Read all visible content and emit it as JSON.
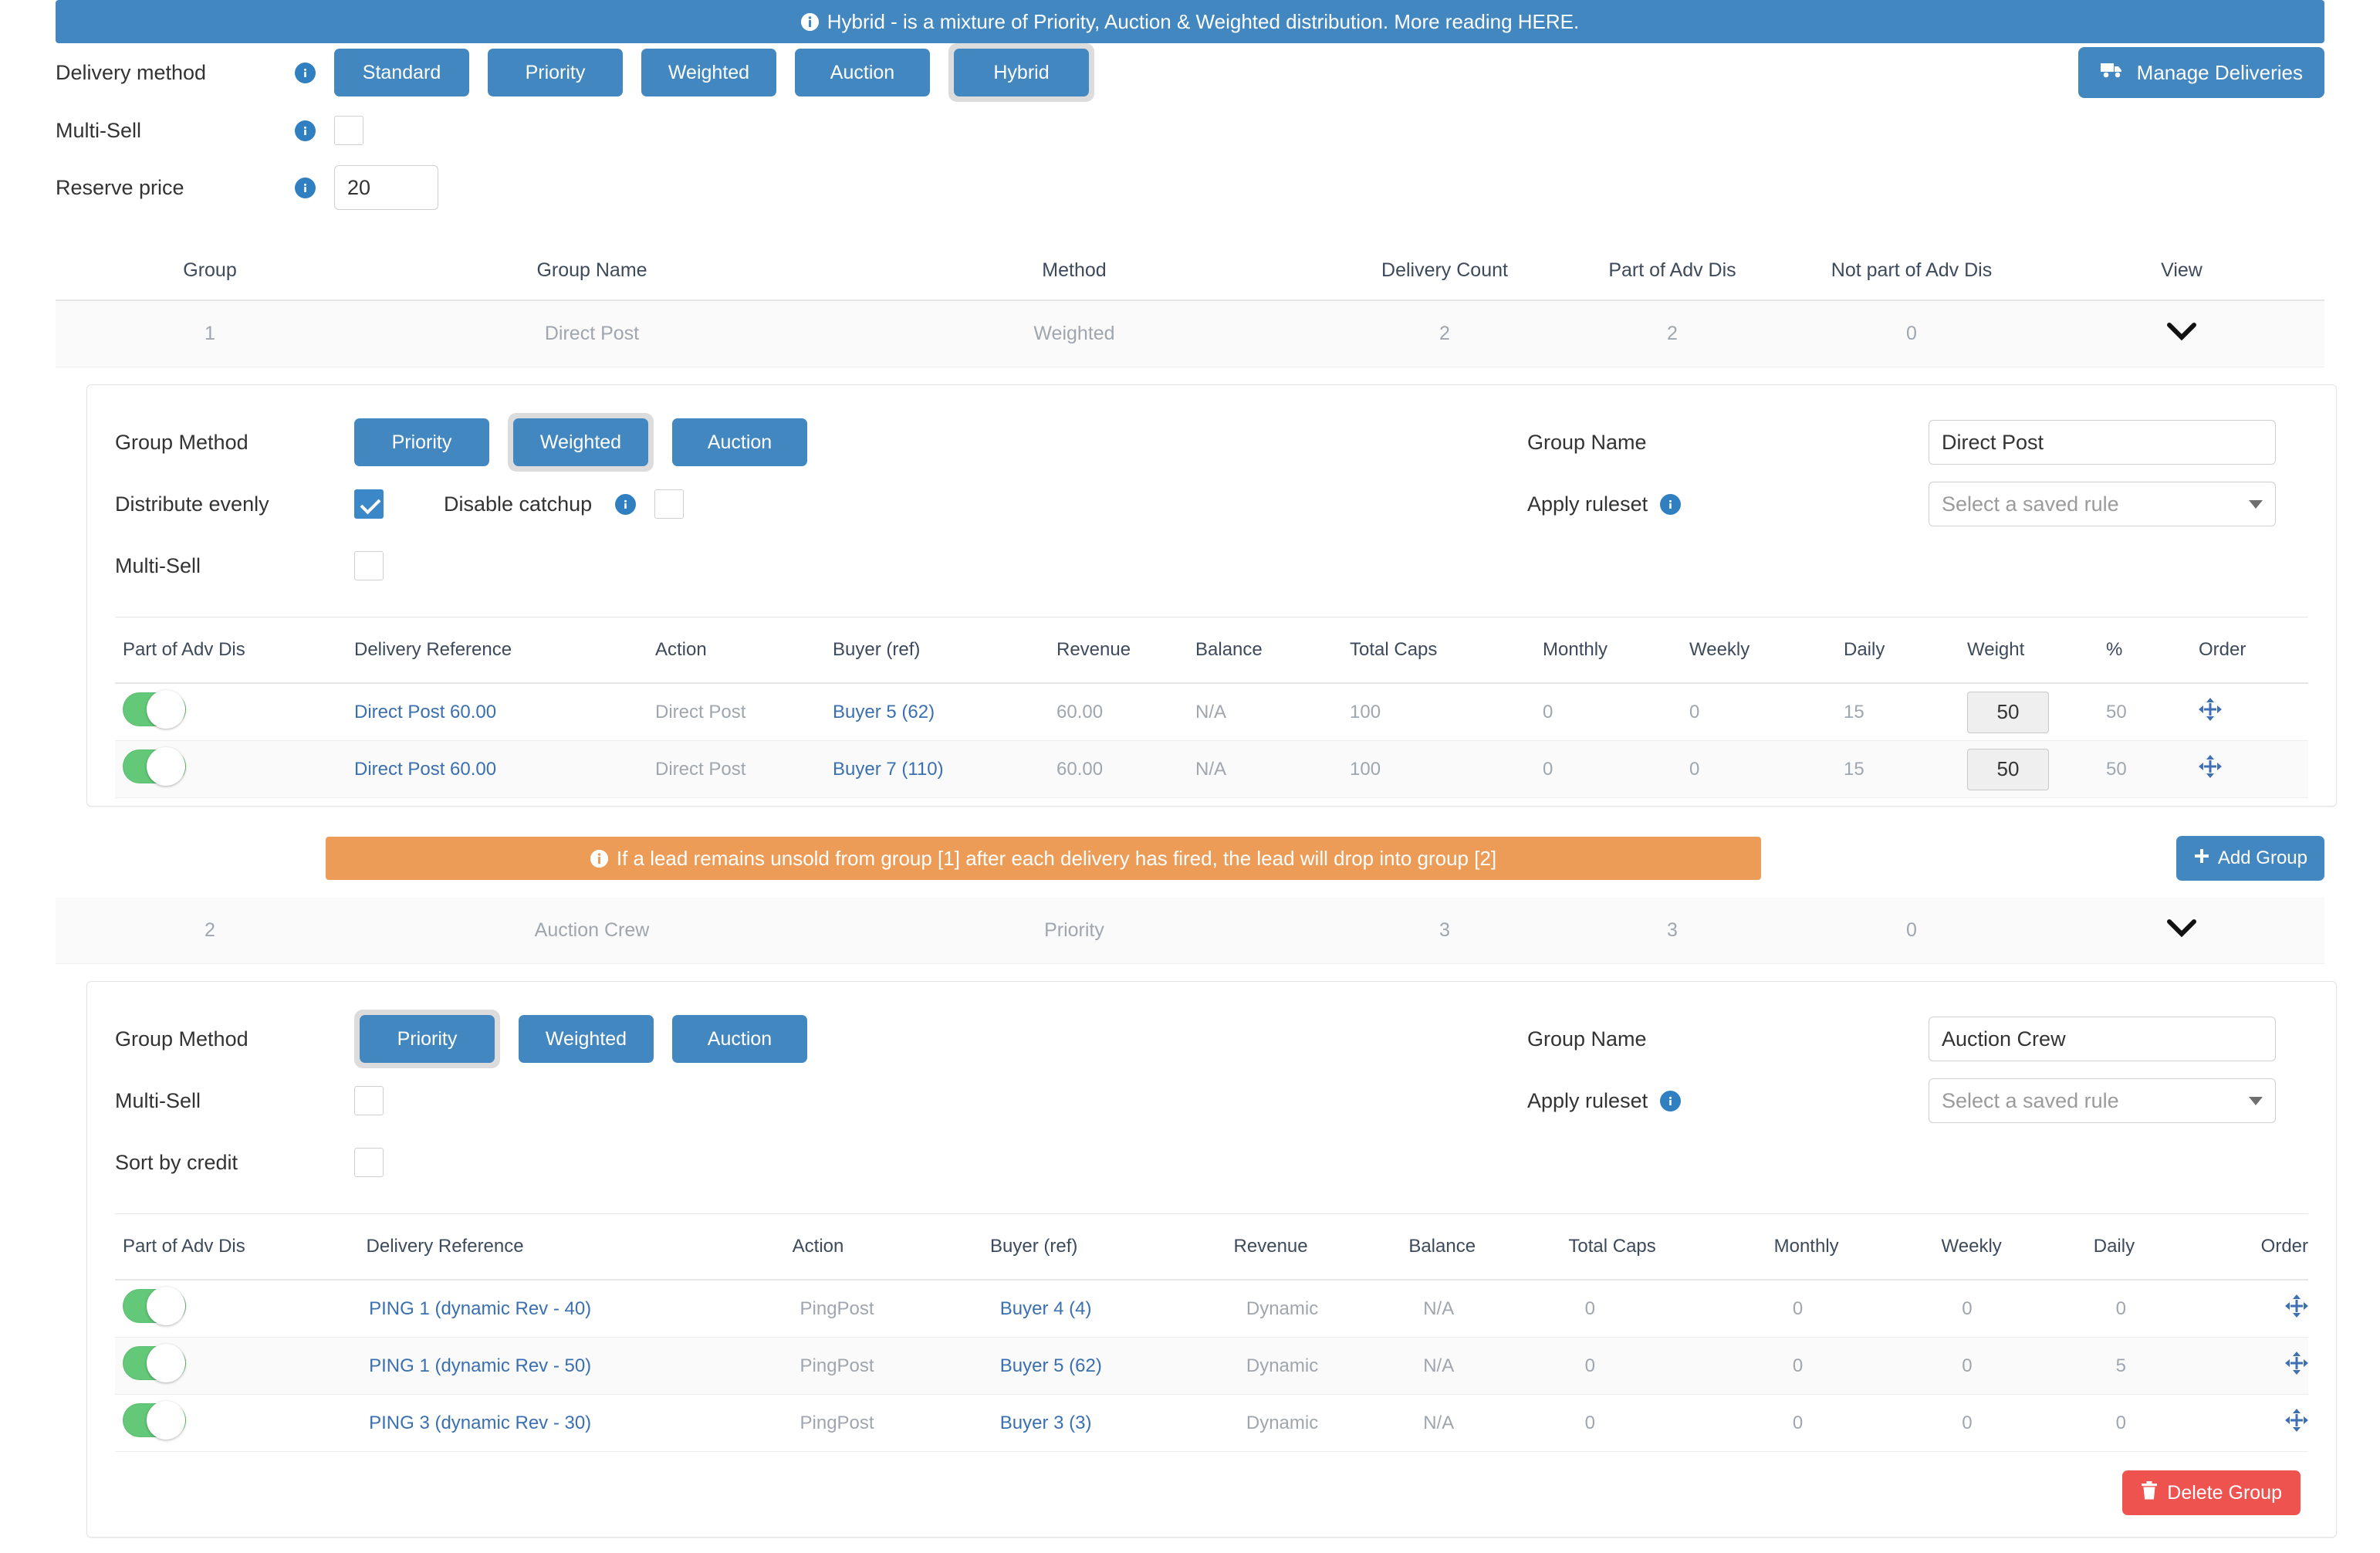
{
  "top_banner": {
    "icon": "info-icon",
    "text": "Hybrid - is a mixture of Priority, Auction & Weighted distribution. More reading HERE."
  },
  "delivery_method": {
    "label": "Delivery method",
    "info_icon": "info-icon",
    "options": [
      "Standard",
      "Priority",
      "Weighted",
      "Auction",
      "Hybrid"
    ],
    "selected": "Hybrid"
  },
  "manage_deliveries": {
    "label": "Manage Deliveries",
    "icon": "truck-icon"
  },
  "multi_sell": {
    "label": "Multi-Sell",
    "info_icon": "info-icon",
    "checked": false
  },
  "reserve_price": {
    "label": "Reserve price",
    "info_icon": "info-icon",
    "value": "20"
  },
  "group_table": {
    "headers": [
      "Group",
      "Group Name",
      "Method",
      "Delivery Count",
      "Part of Adv Dis",
      "Not part of Adv Dis",
      "View"
    ],
    "rows": [
      {
        "group": "1",
        "name": "Direct Post",
        "method": "Weighted",
        "delivery_count": "2",
        "part_adv": "2",
        "not_part_adv": "0",
        "view_icon": "chevron-down-icon"
      },
      {
        "group": "2",
        "name": "Auction Crew",
        "method": "Priority",
        "delivery_count": "3",
        "part_adv": "3",
        "not_part_adv": "0",
        "view_icon": "chevron-down-icon"
      }
    ]
  },
  "middle_banner": {
    "icon": "info-icon",
    "text": "If a lead remains unsold from group [1] after each delivery has fired, the lead will drop into group [2]"
  },
  "add_group": {
    "label": "Add Group",
    "icon": "plus-icon"
  },
  "delete_group": {
    "label": "Delete Group",
    "icon": "trash-icon"
  },
  "group1": {
    "group_method": {
      "label": "Group Method",
      "options": [
        "Priority",
        "Weighted",
        "Auction"
      ],
      "selected": "Weighted"
    },
    "distribute_evenly": {
      "label": "Distribute evenly",
      "checked": true
    },
    "disable_catchup": {
      "label": "Disable catchup",
      "info_icon": "info-icon",
      "checked": false
    },
    "multi_sell": {
      "label": "Multi-Sell",
      "checked": false
    },
    "group_name": {
      "label": "Group Name",
      "value": "Direct Post"
    },
    "apply_ruleset": {
      "label": "Apply ruleset",
      "info_icon": "info-icon",
      "placeholder": "Select a saved rule"
    },
    "delivery_headers": [
      "Part of Adv Dis",
      "Delivery Reference",
      "Action",
      "Buyer (ref)",
      "Revenue",
      "Balance",
      "Total Caps",
      "Monthly",
      "Weekly",
      "Daily",
      "Weight",
      "%",
      "Order"
    ],
    "deliveries": [
      {
        "part_of_adv_dis": true,
        "reference": "Direct Post 60.00",
        "action": "Direct Post",
        "buyer": "Buyer 5 (62)",
        "revenue": "60.00",
        "balance": "N/A",
        "total_caps": "100",
        "monthly": "0",
        "weekly": "0",
        "daily": "15",
        "weight": "50",
        "percent": "50",
        "order_icon": "move-icon"
      },
      {
        "part_of_adv_dis": true,
        "reference": "Direct Post 60.00",
        "action": "Direct Post",
        "buyer": "Buyer 7 (110)",
        "revenue": "60.00",
        "balance": "N/A",
        "total_caps": "100",
        "monthly": "0",
        "weekly": "0",
        "daily": "15",
        "weight": "50",
        "percent": "50",
        "order_icon": "move-icon"
      }
    ]
  },
  "group2": {
    "group_method": {
      "label": "Group Method",
      "options": [
        "Priority",
        "Weighted",
        "Auction"
      ],
      "selected": "Priority"
    },
    "multi_sell": {
      "label": "Multi-Sell",
      "checked": false
    },
    "sort_by_credit": {
      "label": "Sort by credit",
      "checked": false
    },
    "group_name": {
      "label": "Group Name",
      "value": "Auction Crew"
    },
    "apply_ruleset": {
      "label": "Apply ruleset",
      "info_icon": "info-icon",
      "placeholder": "Select a saved rule"
    },
    "delivery_headers": [
      "Part of Adv Dis",
      "Delivery Reference",
      "Action",
      "Buyer (ref)",
      "Revenue",
      "Balance",
      "Total Caps",
      "Monthly",
      "Weekly",
      "Daily",
      "Order"
    ],
    "deliveries": [
      {
        "part_of_adv_dis": true,
        "reference": "PING 1 (dynamic Rev - 40)",
        "action": "PingPost",
        "buyer": "Buyer 4 (4)",
        "revenue": "Dynamic",
        "balance": "N/A",
        "total_caps": "0",
        "monthly": "0",
        "weekly": "0",
        "daily": "0",
        "order_icon": "move-icon"
      },
      {
        "part_of_adv_dis": true,
        "reference": "PING 1 (dynamic Rev - 50)",
        "action": "PingPost",
        "buyer": "Buyer 5 (62)",
        "revenue": "Dynamic",
        "balance": "N/A",
        "total_caps": "0",
        "monthly": "0",
        "weekly": "0",
        "daily": "5",
        "order_icon": "move-icon"
      },
      {
        "part_of_adv_dis": true,
        "reference": "PING 3 (dynamic Rev - 30)",
        "action": "PingPost",
        "buyer": "Buyer 3 (3)",
        "revenue": "Dynamic",
        "balance": "N/A",
        "total_caps": "0",
        "monthly": "0",
        "weekly": "0",
        "daily": "0",
        "order_icon": "move-icon"
      }
    ]
  },
  "colors": {
    "accent": "#4387c0",
    "warn": "#ed9c57",
    "toggle_on": "#63c878",
    "danger": "#ef5350"
  }
}
